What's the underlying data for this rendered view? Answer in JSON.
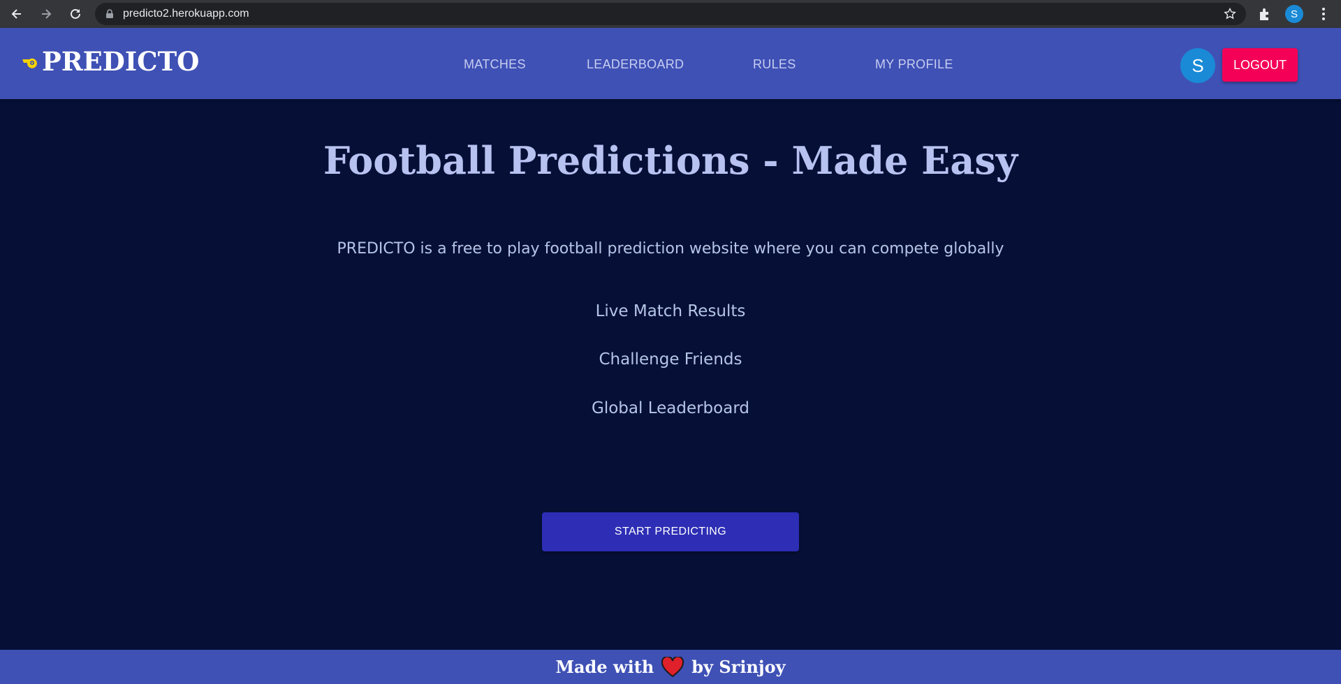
{
  "browser": {
    "url": "predicto2.herokuapp.com",
    "profile_initial": "S",
    "icons": [
      "back-icon",
      "forward-icon",
      "reload-icon",
      "lock-icon",
      "star-icon",
      "extensions-icon",
      "menu-icon"
    ]
  },
  "header": {
    "brand": "PREDICTO",
    "nav": {
      "matches": "MATCHES",
      "leaderboard": "LEADERBOARD",
      "rules": "RULES",
      "profile": "MY PROFILE"
    },
    "avatar_initial": "S",
    "logout_label": "LOGOUT"
  },
  "hero": {
    "title": "Football Predictions - Made Easy",
    "tagline": "PREDICTO is a free to play football prediction website where you can compete globally",
    "features": [
      "Live Match Results",
      "Challenge Friends",
      "Global Leaderboard"
    ],
    "cta_label": "START PREDICTING"
  },
  "footer": {
    "prefix": "Made with",
    "suffix": "by Srinjoy"
  },
  "colors": {
    "header_bg": "#3f51b5",
    "page_bg": "#061037",
    "logout_bg": "#f50057",
    "cta_bg": "#2d2db5",
    "avatar_bg": "#1a8ad6"
  }
}
